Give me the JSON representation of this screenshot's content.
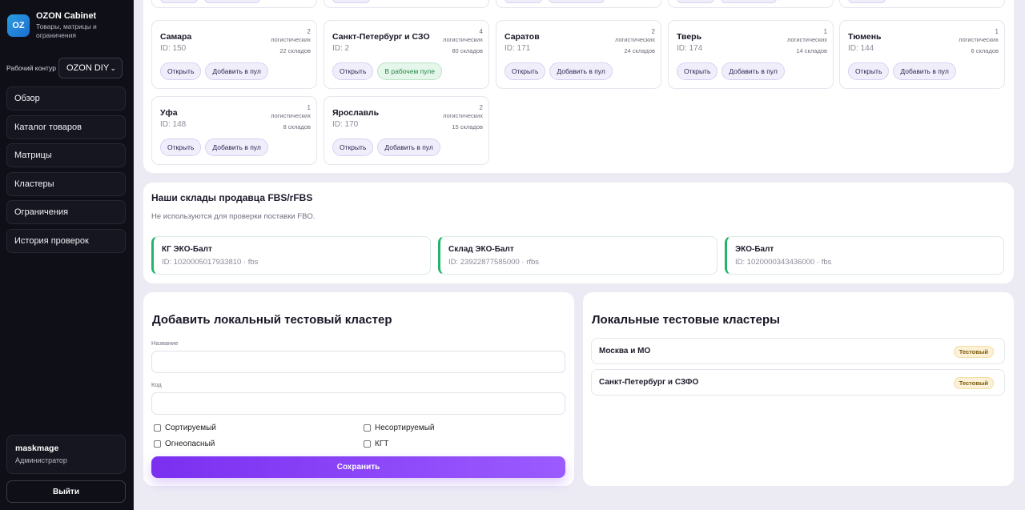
{
  "sidebar": {
    "logo_text": "OZ",
    "title": "OZON Cabinet",
    "subtitle": "Товары, матрицы и ограничения",
    "workspace_label": "Рабочий контур",
    "workspace_value": "OZON DIY",
    "nav": [
      "Обзор",
      "Каталог товаров",
      "Матрицы",
      "Кластеры",
      "Ограничения",
      "История проверок"
    ],
    "user_name": "maskmage",
    "user_role": "Администратор",
    "logout_label": "Выйти"
  },
  "clusters": [
    {
      "name": "Самара",
      "id": "ID: 150",
      "count": "2",
      "unit": "логистических",
      "warehouses": "22 складов",
      "open": "Открыть",
      "action": "Добавить в пул",
      "in_pool": false
    },
    {
      "name": "Санкт-Петербург и СЗО",
      "id": "ID: 2",
      "count": "4",
      "unit": "логистических",
      "warehouses": "80 складов",
      "open": "Открыть",
      "action": "В рабочем пуле",
      "in_pool": true
    },
    {
      "name": "Саратов",
      "id": "ID: 171",
      "count": "2",
      "unit": "логистических",
      "warehouses": "24 складов",
      "open": "Открыть",
      "action": "Добавить в пул",
      "in_pool": false
    },
    {
      "name": "Тверь",
      "id": "ID: 174",
      "count": "1",
      "unit": "логистических",
      "warehouses": "14 складов",
      "open": "Открыть",
      "action": "Добавить в пул",
      "in_pool": false
    },
    {
      "name": "Тюмень",
      "id": "ID: 144",
      "count": "1",
      "unit": "логистических",
      "warehouses": "6 складов",
      "open": "Открыть",
      "action": "Добавить в пул",
      "in_pool": false
    },
    {
      "name": "Уфа",
      "id": "ID: 148",
      "count": "1",
      "unit": "логистических",
      "warehouses": "8 складов",
      "open": "Открыть",
      "action": "Добавить в пул",
      "in_pool": false
    },
    {
      "name": "Ярославль",
      "id": "ID: 170",
      "count": "2",
      "unit": "логистических",
      "warehouses": "15 складов",
      "open": "Открыть",
      "action": "Добавить в пул",
      "in_pool": false
    }
  ],
  "seller_warehouses": {
    "title": "Наши склады продавца FBS/rFBS",
    "subtitle": "Не используются для проверки поставки FBO.",
    "items": [
      {
        "name": "КГ ЭКО-Балт",
        "meta": "ID: 1020005017933810 · fbs"
      },
      {
        "name": "Склад ЭКО-Балт",
        "meta": "ID: 23922877585000 · rfbs"
      },
      {
        "name": "ЭКО-Балт",
        "meta": "ID: 1020000343436000 · fbs"
      }
    ]
  },
  "add_cluster": {
    "title": "Добавить локальный тестовый кластер",
    "name_label": "Название",
    "code_label": "Код",
    "checkboxes": [
      "Сортируемый",
      "Несортируемый",
      "Огнеопасный",
      "КГТ"
    ],
    "save_label": "Сохранить"
  },
  "local_clusters": {
    "title": "Локальные тестовые кластеры",
    "items": [
      {
        "name": "Москва и МО",
        "badge": "Тестовый"
      },
      {
        "name": "Санкт-Петербург и СЗФО",
        "badge": "Тестовый"
      }
    ]
  },
  "colors": {
    "accent": "#7c3aed",
    "sidebar_bg": "#0e0f17",
    "page_bg": "#ecebf4",
    "success": "#22b56a"
  }
}
